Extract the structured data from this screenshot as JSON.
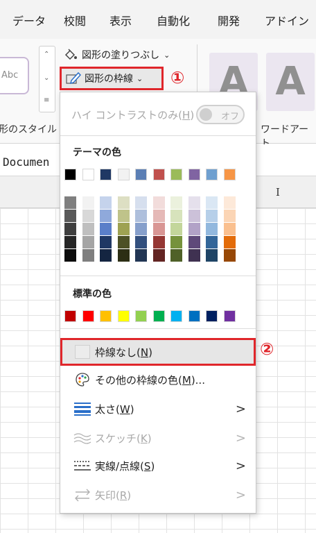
{
  "tabs": [
    "データ",
    "校閲",
    "表示",
    "自動化",
    "開発",
    "アドイン"
  ],
  "ribbon": {
    "gallery_sample": "Abc",
    "shape_styles_label": "形のスタイル",
    "fill_label": "図形の塗りつぶし",
    "outline_label": "図形の枠線",
    "callout_1": "①",
    "callout_2": "②",
    "wordart_letter": "A",
    "wordart_label": "ワードアート"
  },
  "formula_bar_text": "Documen",
  "column_header": "I",
  "menu": {
    "high_contrast": {
      "label": "ハイ コントラストのみ(",
      "key": "H",
      "tail": ")",
      "toggle": "オフ"
    },
    "theme_colors_title": "テーマの色",
    "theme_colors": [
      "#000000",
      "#ffffff",
      "#1f3864",
      "#f2f2f2",
      "#5b7fb5",
      "#c0504d",
      "#9bbb59",
      "#8064a2",
      "#6fa0d0",
      "#f79646"
    ],
    "theme_shades": [
      [
        "#7f7f7f",
        "#595959",
        "#3f3f3f",
        "#262626",
        "#0c0c0c"
      ],
      [
        "#f2f2f2",
        "#d8d8d8",
        "#bfbfbf",
        "#a5a5a5",
        "#7f7f7f"
      ],
      [
        "#c5d3ec",
        "#8fa9db",
        "#5a7fc9",
        "#1f3864",
        "#142541"
      ],
      [
        "#dddfc3",
        "#bfc38a",
        "#9ea252",
        "#4d5126",
        "#2c2e14"
      ],
      [
        "#d6dfee",
        "#aebfdc",
        "#869fcb",
        "#33507e",
        "#223654"
      ],
      [
        "#f2dcdb",
        "#e5b9b7",
        "#d99694",
        "#953734",
        "#632523"
      ],
      [
        "#ebf1dd",
        "#d7e3bc",
        "#c3d69b",
        "#76923c",
        "#4f6128"
      ],
      [
        "#e5e0ec",
        "#ccc1d9",
        "#b2a2c7",
        "#5f497a",
        "#3f3151"
      ],
      [
        "#dae7f4",
        "#b6cfe9",
        "#92b8de",
        "#336699",
        "#1f4466"
      ],
      [
        "#fde9d9",
        "#fbd5b5",
        "#fac08f",
        "#e36c09",
        "#974806"
      ]
    ],
    "standard_colors_title": "標準の色",
    "standard_colors": [
      "#c00000",
      "#ff0000",
      "#ffc000",
      "#ffff00",
      "#92d050",
      "#00b050",
      "#00b0f0",
      "#0070c0",
      "#002060",
      "#7030a0"
    ],
    "no_outline": {
      "label": "枠線なし(",
      "key": "N",
      "tail": ")"
    },
    "more_colors": {
      "label": "その他の枠線の色(",
      "key": "M",
      "tail": ")..."
    },
    "weight": {
      "label": "太さ(",
      "key": "W",
      "tail": ")"
    },
    "sketched": {
      "label": "スケッチ(",
      "key": "K",
      "tail": ")"
    },
    "dashes": {
      "label": "実線/点線(",
      "key": "S",
      "tail": ")"
    },
    "arrows": {
      "label": "矢印(",
      "key": "R",
      "tail": ")"
    }
  }
}
